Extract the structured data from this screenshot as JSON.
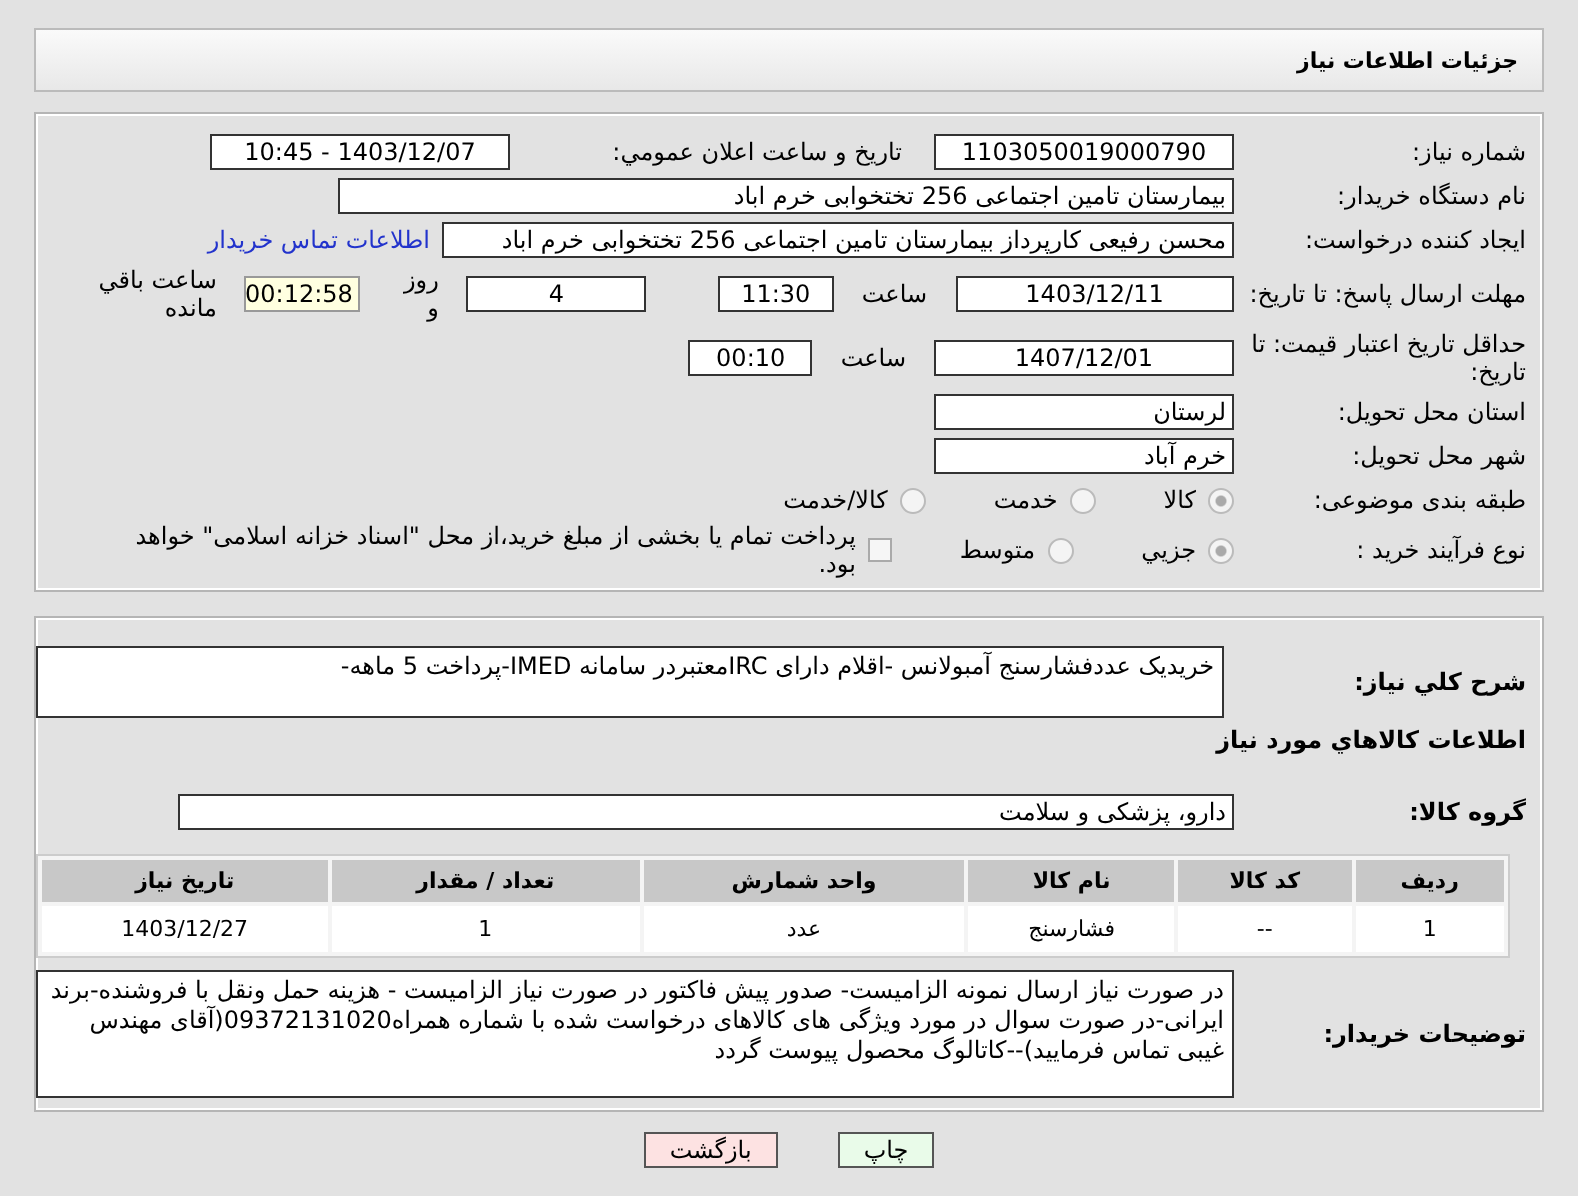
{
  "header": {
    "title": "جزئیات اطلاعات نیاز"
  },
  "need_number": {
    "label": "شماره نیاز:",
    "value": "1103050019000790"
  },
  "announce": {
    "label": "تاریخ و ساعت اعلان عمومي:",
    "value": "1403/12/07 - 10:45"
  },
  "buyer": {
    "label": "نام دستگاه خریدار:",
    "value": "بیمارستان تامین اجتماعی  256 تختخوابی خرم اباد"
  },
  "creator": {
    "label": "ایجاد کننده درخواست:",
    "value": "محسن رفیعی کارپرداز بیمارستان تامین اجتماعی  256 تختخوابی خرم اباد",
    "link": "اطلاعات تماس خریدار"
  },
  "deadline": {
    "label": "مهلت ارسال پاسخ: تا تاریخ:",
    "date": "1403/12/11",
    "time_label": "ساعت",
    "time": "11:30",
    "days": "4",
    "days_label": "روز و",
    "remaining": "00:12:58",
    "remaining_label": "ساعت باقي مانده"
  },
  "validity": {
    "label": "حداقل تاریخ اعتبار قیمت: تا تاریخ:",
    "date": "1407/12/01",
    "time_label": "ساعت",
    "time": "00:10"
  },
  "province": {
    "label": "استان محل تحویل:",
    "value": "لرستان"
  },
  "city": {
    "label": "شهر محل تحویل:",
    "value": "خرم آباد"
  },
  "category": {
    "label": "طبقه بندی موضوعی:",
    "options": [
      {
        "label": "کالا",
        "selected": true
      },
      {
        "label": "خدمت",
        "selected": false
      },
      {
        "label": "کالا/خدمت",
        "selected": false
      }
    ]
  },
  "process": {
    "label": "نوع فرآیند خرید :",
    "options": [
      {
        "label": "جزیي",
        "selected": true
      },
      {
        "label": "متوسط",
        "selected": false
      }
    ],
    "payment": {
      "checked": false,
      "label": "پرداخت تمام یا بخشی از مبلغ خرید،از محل \"اسناد خزانه اسلامی\" خواهد بود."
    }
  },
  "summary": {
    "label": "شرح كلي نياز:",
    "value": "خریدیک عددفشارسنج آمبولانس -اقلام دارای IRCمعتبردر سامانه IMED-پرداخت 5 ماهه-"
  },
  "goods_title": "اطلاعات كالاهاي مورد نياز",
  "group": {
    "label": "گروه کالا:",
    "value": "دارو، پزشکی و سلامت"
  },
  "table": {
    "columns": [
      "ردیف",
      "کد کالا",
      "نام کالا",
      "واحد شمارش",
      "تعداد / مقدار",
      "تاریخ نیاز"
    ],
    "rows": [
      [
        "1",
        "--",
        "فشارسنج",
        "عدد",
        "1",
        "1403/12/27"
      ]
    ]
  },
  "notes": {
    "label": "توضیحات خریدار:",
    "value": "در صورت نیاز ارسال نمونه الزامیست- صدور پیش فاکتور در صورت نیاز الزامیست - هزینه حمل ونقل با فروشنده-برند ایرانی-در صورت سوال در مورد ویژگی های کالاهای درخواست شده با شماره همراه09372131020(آقای مهندس غیبی تماس فرمایید)--کاتالوگ محصول پیوست گردد"
  },
  "buttons": [
    {
      "label": "چاپ",
      "kind": "print"
    },
    {
      "label": "بازگشت",
      "kind": "back"
    }
  ]
}
